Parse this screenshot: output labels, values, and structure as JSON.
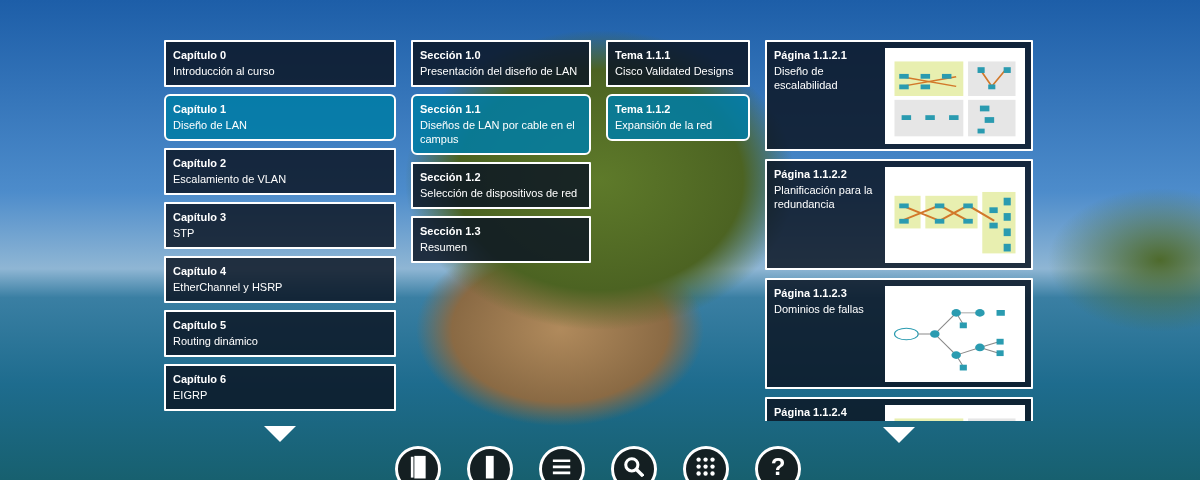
{
  "chapters": [
    {
      "label": "Capítulo 0",
      "title": "Introducción al curso",
      "selected": false
    },
    {
      "label": "Capítulo 1",
      "title": "Diseño de LAN",
      "selected": true
    },
    {
      "label": "Capítulo 2",
      "title": "Escalamiento de VLAN",
      "selected": false
    },
    {
      "label": "Capítulo 3",
      "title": "STP",
      "selected": false
    },
    {
      "label": "Capítulo 4",
      "title": "EtherChannel y HSRP",
      "selected": false
    },
    {
      "label": "Capítulo 5",
      "title": "Routing dinámico",
      "selected": false
    },
    {
      "label": "Capítulo 6",
      "title": "EIGRP",
      "selected": false
    }
  ],
  "sections": [
    {
      "label": "Sección 1.0",
      "title": "Presentación del diseño de LAN",
      "selected": false
    },
    {
      "label": "Sección 1.1",
      "title": "Diseños de LAN por cable en el campus",
      "selected": true
    },
    {
      "label": "Sección 1.2",
      "title": "Selección de dispositivos de red",
      "selected": false
    },
    {
      "label": "Sección 1.3",
      "title": "Resumen",
      "selected": false
    }
  ],
  "topics": [
    {
      "label": "Tema 1.1.1",
      "title": "Cisco Validated Designs",
      "selected": false
    },
    {
      "label": "Tema 1.1.2",
      "title": "Expansión de la red",
      "selected": true
    }
  ],
  "pages": [
    {
      "label": "Página 1.1.2.1",
      "title": "Diseño de escalabilidad"
    },
    {
      "label": "Página 1.1.2.2",
      "title": "Planificación para la redundancia"
    },
    {
      "label": "Página 1.1.2.3",
      "title": "Dominios de fallas"
    },
    {
      "label": "Página 1.1.2.4"
    }
  ],
  "toolbar": [
    {
      "kind": "book"
    },
    {
      "kind": "bookmark"
    },
    {
      "kind": "menu"
    },
    {
      "kind": "search"
    },
    {
      "kind": "apps"
    },
    {
      "kind": "help",
      "label": "?"
    }
  ]
}
